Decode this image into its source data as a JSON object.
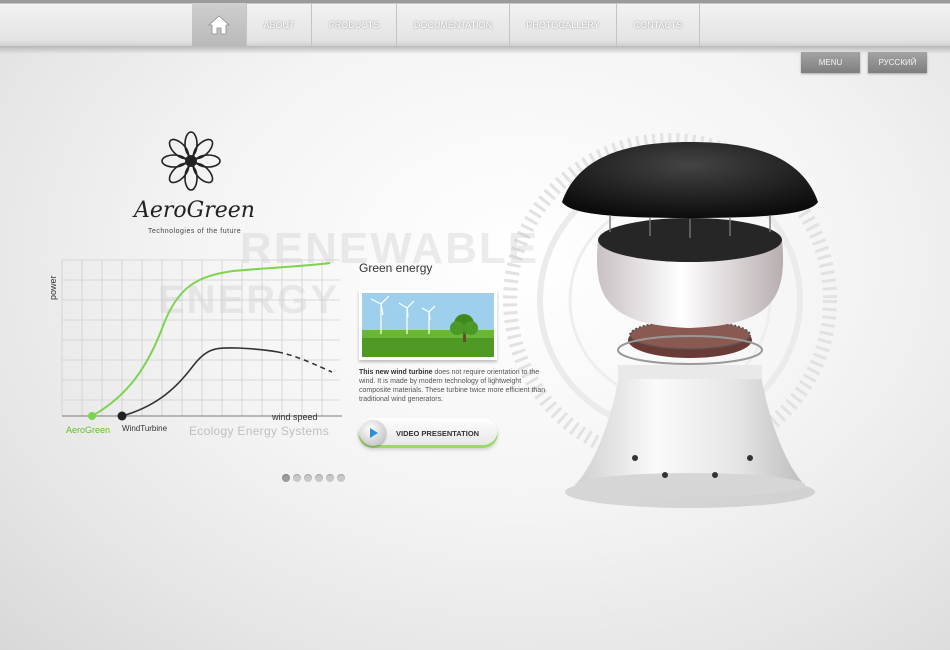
{
  "nav": {
    "home_icon": "home-icon",
    "items": [
      {
        "label": "ABOUT"
      },
      {
        "label": "PRODUCTS"
      },
      {
        "label": "DOCUMENTATION"
      },
      {
        "label": "PHOTOGALLERY"
      },
      {
        "label": "CONTACTS"
      }
    ]
  },
  "top_buttons": {
    "menu": "MENU",
    "lang": "РУССКИЙ"
  },
  "logo": {
    "name": "AeroGreen",
    "tagline": "Technologies of the future"
  },
  "background_words": [
    "RENEWABLE",
    "ENERGY"
  ],
  "graph": {
    "axis_y": "power",
    "axis_x": "wind speed",
    "series": [
      {
        "name": "AeroGreen",
        "color": "#7ed34f"
      },
      {
        "name": "WindTurbine",
        "color": "#333333"
      }
    ],
    "caption": "Ecology  Energy  Systems"
  },
  "promo": {
    "heading": "Green energy",
    "desc_bold": "This new wind turbine",
    "desc_rest": " does not require orientation to the wind. It is made by modern technology of lightweight composite materials. These turbine twice more efficient than traditional wind generators.",
    "video_label": "VIDEO PRESENTATION"
  },
  "slider": {
    "total": 6,
    "active": 1
  }
}
